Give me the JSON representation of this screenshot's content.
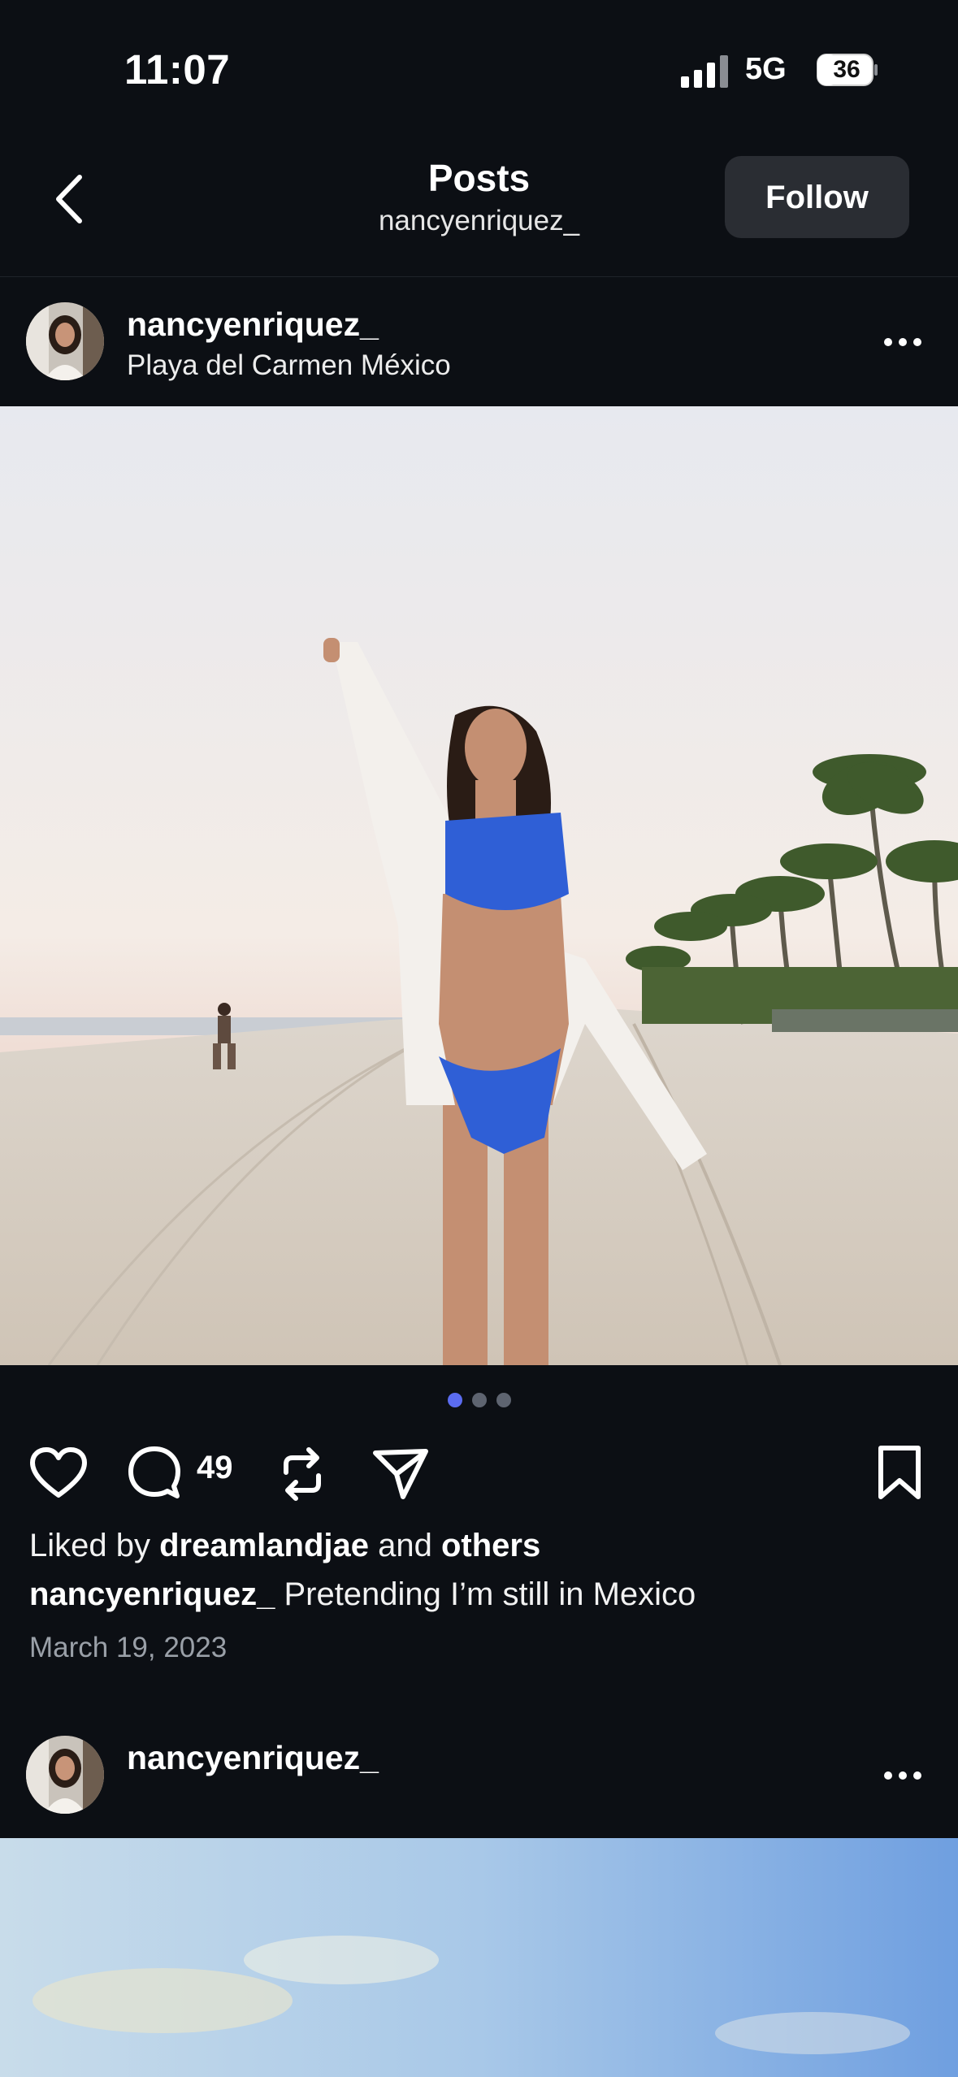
{
  "status_bar": {
    "time": "11:07",
    "network": "5G",
    "battery": "36"
  },
  "header": {
    "title": "Posts",
    "subtitle": "nancyenriquez_",
    "follow_label": "Follow"
  },
  "post": {
    "username": "nancyenriquez_",
    "location": "Playa del Carmen México",
    "comment_count": "49",
    "likes_prefix": "Liked by ",
    "likes_user": "dreamlandjae",
    "likes_middle": " and ",
    "likes_others": "others",
    "caption_user": "nancyenriquez_",
    "caption_text": " Pretending I’m still in Mexico",
    "date": "March 19, 2023",
    "carousel_total": 3,
    "carousel_active": 1
  },
  "next_post": {
    "username": "nancyenriquez_"
  },
  "colors": {
    "background": "#0c0f14",
    "follow_button": "#2a2d33",
    "dot_active": "#5b6cf0",
    "dot_inactive": "#5e6470",
    "date_text": "#9aa0a8"
  },
  "icons": [
    "back-icon",
    "more-icon",
    "like-icon",
    "comment-icon",
    "repost-icon",
    "share-icon",
    "bookmark-icon",
    "signal-icon",
    "battery-icon"
  ]
}
